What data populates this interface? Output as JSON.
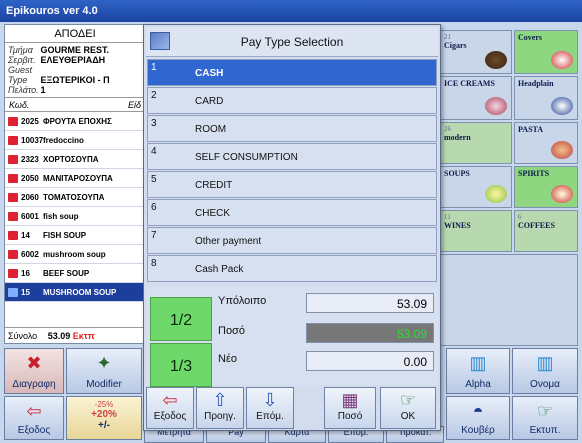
{
  "window": {
    "title": "Epikouros ver 4.0"
  },
  "receipt": {
    "title": "ΑΠΟΔΕΙ",
    "info": [
      {
        "key": "Τμήμα",
        "value": "GOURME REST."
      },
      {
        "key": "Σερβιτ.",
        "value": "ΕΛΕΥΘΕΡΙΑΔΗ"
      },
      {
        "key": "Guest Type",
        "value": "ΕΞΩΤΕΡΙΚΟΙ - Π"
      },
      {
        "key": "Πελάτο.",
        "value": "1"
      }
    ],
    "col_code": "Κωδ.",
    "col_item": "Είδ",
    "items": [
      {
        "code": "2025",
        "name": "ΦΡΟΥΤΑ ΕΠΟΧΗΣ"
      },
      {
        "code": "10037",
        "name": "fredoccino"
      },
      {
        "code": "2323",
        "name": "ΧΟΡΤΟΣΟΥΠΑ"
      },
      {
        "code": "2050",
        "name": "ΜΑΝΙΤΑΡΟΣΟΥΠΑ"
      },
      {
        "code": "2060",
        "name": "ΤΟΜΑΤΟΣΟΥΠΑ"
      },
      {
        "code": "6001",
        "name": "fish soup"
      },
      {
        "code": "14",
        "name": "FISH SOUP"
      },
      {
        "code": "6002",
        "name": "mushroom soup"
      },
      {
        "code": "16",
        "name": "BEEF SOUP"
      },
      {
        "code": "15",
        "name": "MUSHROOM SOUP"
      }
    ],
    "total_label": "Σύνολο",
    "total_value": "53.09",
    "total_extra": "Εκτπ"
  },
  "tiles": [
    {
      "num": "21",
      "label": "Cigars"
    },
    {
      "num": "",
      "label": "Covers"
    },
    {
      "num": "",
      "label": "ICE CREAMS"
    },
    {
      "num": "",
      "label": "Headplain"
    },
    {
      "num": "26",
      "label": "modern"
    },
    {
      "num": "",
      "label": "PASTA"
    },
    {
      "num": "",
      "label": "SOUPS"
    },
    {
      "num": "",
      "label": "SPIRITS"
    },
    {
      "num": "11",
      "label": "WINES"
    },
    {
      "num": "6",
      "label": "COFFEES"
    }
  ],
  "bottom": {
    "delete": "Διαγραφη",
    "modifier": "Modifier",
    "exit": "Εξοδος",
    "percent_top": "-25%",
    "percent_mid": "+20%",
    "plusminus": "+/-",
    "metrita": "Μετρητά",
    "pay": "Pay",
    "karta": "Κάρτα",
    "epom": "Επομ.",
    "timokat": "Τιμοκατ.",
    "alpha": "Alpha",
    "onoma": "Ονομα",
    "kouver": "Κουβέρ",
    "ektypt": "Εκτυπ."
  },
  "dialog": {
    "title": "Pay Type Selection",
    "options": [
      {
        "no": "1",
        "name": "CASH"
      },
      {
        "no": "2",
        "name": "CARD"
      },
      {
        "no": "3",
        "name": "ROOM"
      },
      {
        "no": "4",
        "name": "SELF CONSUMPTION"
      },
      {
        "no": "5",
        "name": "CREDIT"
      },
      {
        "no": "6",
        "name": "CHECK"
      },
      {
        "no": "7",
        "name": "Other payment"
      },
      {
        "no": "8",
        "name": "Cash Pack"
      }
    ],
    "selected_index": 0,
    "frac1": "1/2",
    "frac2": "1/3",
    "remaining_label": "Υπόλοιπο",
    "remaining_value": "53.09",
    "amount_label": "Ποσό",
    "amount_value": "53.09",
    "new_label": "Νέο",
    "new_value": "0.00",
    "btn_exit": "Εξοδος",
    "btn_prev": "Προηγ.",
    "btn_next": "Επόμ.",
    "btn_amount": "Ποσό",
    "btn_ok": "OK"
  },
  "colors": {
    "title_bar": "#1a44a3",
    "selected": "#2f66d0",
    "accent_green": "#6ed86a",
    "amount_text": "#2cdd38"
  }
}
